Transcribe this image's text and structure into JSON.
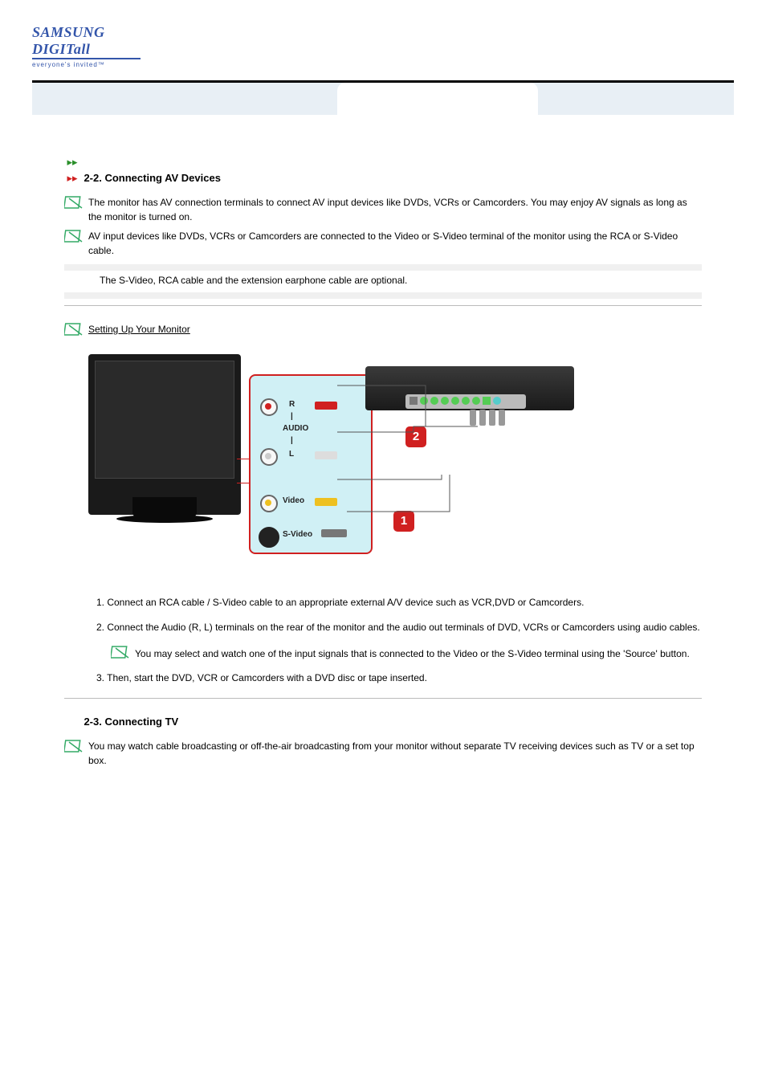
{
  "logo": {
    "main": "SAMSUNG DIGITall",
    "tagline": "everyone's invited™"
  },
  "headers": {
    "h1": "2-2. Connecting AV Devices",
    "h2": "2-3. Connecting TV"
  },
  "notes": {
    "n1": "The monitor has AV connection terminals to connect AV input devices like DVDs, VCRs or Camcorders. You may enjoy AV signals as long as the monitor is turned on.",
    "n2": "AV input devices like DVDs, VCRs or Camcorders are connected to the Video or S-Video terminal of the monitor using the RCA or S-Video cable.",
    "n2b": "The S-Video, RCA cable and the extension earphone cable are optional.",
    "port_r": "R",
    "port_audio": "AUDIO",
    "port_l": "L",
    "port_video": "Video",
    "port_svideo": "S-Video",
    "step1": "1. Connect an RCA cable / S-Video cable to an appropriate external A/V device such as VCR,DVD or Camcorders.",
    "step2": "2. Connect the Audio (R, L) terminals on the rear of the monitor and the audio out terminals of DVD, VCRs or Camcorders using audio cables.",
    "inner_note": "You may select and watch one of the input signals that is connected to the Video or the S-Video terminal using the 'Source' button.",
    "step3_intro": "3. Then, start the DVD, VCR or Camcorders with a DVD disc or tape inserted.",
    "tv_note": "You may watch cable broadcasting or off-the-air broadcasting from your monitor without separate TV receiving devices such as TV or a set top box."
  },
  "link": "Setting Up Your Monitor",
  "badges": {
    "b1": "1",
    "b2": "2"
  }
}
